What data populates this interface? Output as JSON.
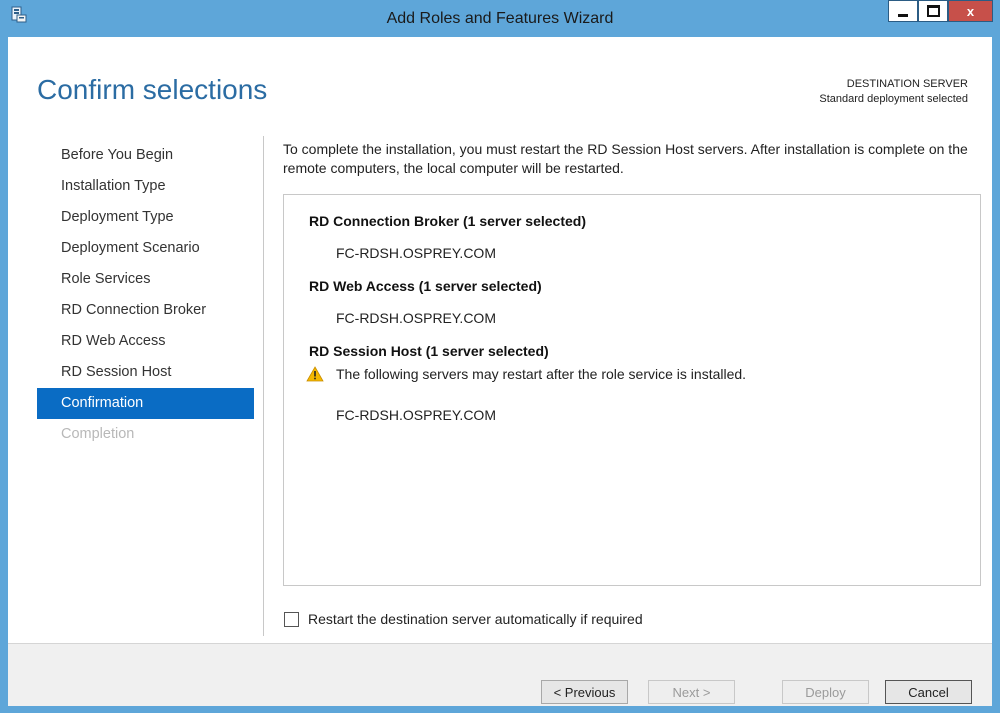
{
  "window": {
    "title": "Add Roles and Features Wizard",
    "close_label": "x"
  },
  "page": {
    "title": "Confirm selections",
    "destination_label": "DESTINATION SERVER",
    "destination_value": "Standard deployment selected"
  },
  "nav": {
    "items": [
      {
        "label": "Before You Begin",
        "state": "normal"
      },
      {
        "label": "Installation Type",
        "state": "normal"
      },
      {
        "label": "Deployment Type",
        "state": "normal"
      },
      {
        "label": "Deployment Scenario",
        "state": "normal"
      },
      {
        "label": "Role Services",
        "state": "normal"
      },
      {
        "label": "RD Connection Broker",
        "state": "normal"
      },
      {
        "label": "RD Web Access",
        "state": "normal"
      },
      {
        "label": "RD Session Host",
        "state": "normal"
      },
      {
        "label": "Confirmation",
        "state": "active"
      },
      {
        "label": "Completion",
        "state": "disabled"
      }
    ]
  },
  "content": {
    "intro": "To complete the installation, you must restart the RD Session Host servers. After installation is complete on the remote computers, the local computer will be restarted.",
    "groups": [
      {
        "heading": "RD Connection Broker  (1 server selected)",
        "server": "FC-RDSH.OSPREY.COM"
      },
      {
        "heading": "RD Web Access  (1 server selected)",
        "server": "FC-RDSH.OSPREY.COM"
      },
      {
        "heading": "RD Session Host  (1 server selected)",
        "warning": "The following servers may restart after the role service is installed.",
        "server": "FC-RDSH.OSPREY.COM"
      }
    ],
    "restart_checkbox_label": "Restart the destination server automatically if required",
    "restart_checked": false
  },
  "footer": {
    "previous": "< Previous",
    "next": "Next >",
    "deploy": "Deploy",
    "cancel": "Cancel"
  },
  "colors": {
    "accent": "#0a6cc4",
    "title_blue": "#2b6ca3",
    "chrome": "#5ea6d9",
    "close": "#c7504a",
    "warning": "#f5b800"
  },
  "icons": {
    "app": "server-manager-icon",
    "warning": "warning-icon",
    "minimize": "minimize-icon",
    "maximize": "maximize-icon"
  }
}
